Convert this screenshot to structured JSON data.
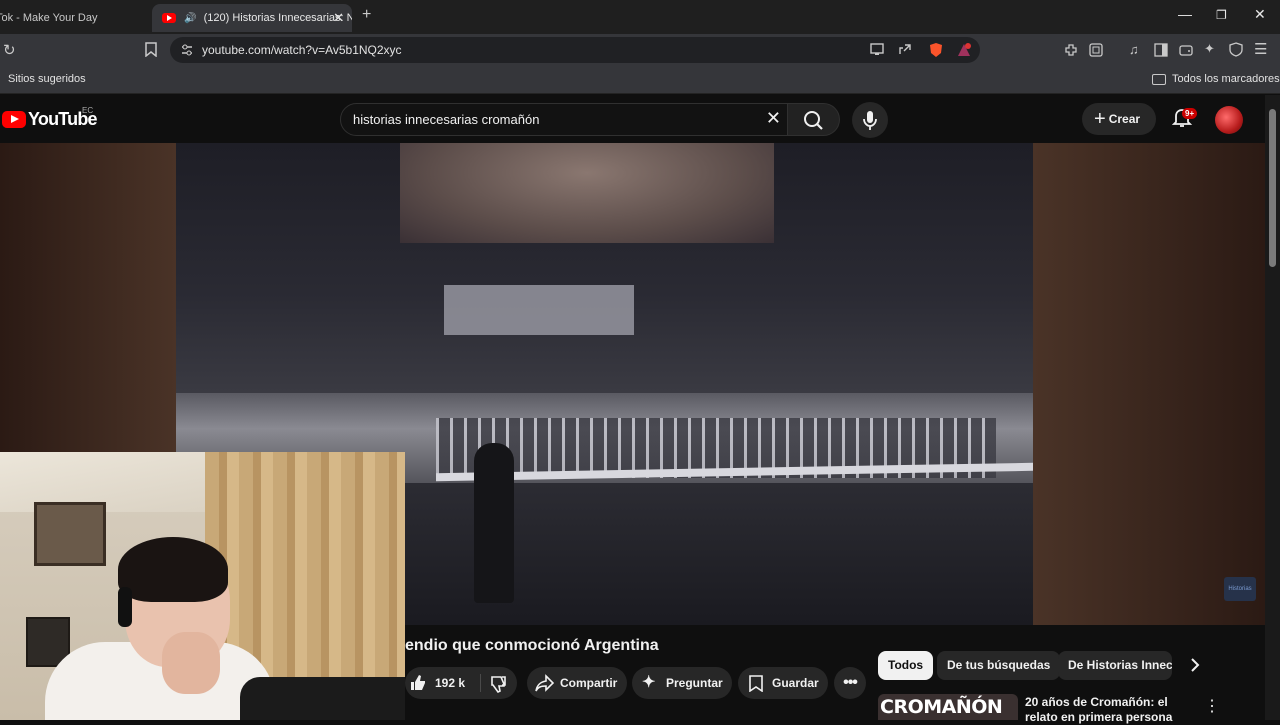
{
  "browser": {
    "tabs": [
      {
        "label": "Tok - Make Your Day"
      },
      {
        "label": "(120) Historias Innecesarias: N"
      }
    ],
    "url": "youtube.com/watch?v=Av5b1NQ2xyc",
    "bookmarks": {
      "suggested": "Sitios sugeridos",
      "all": "Todos los marcadores"
    }
  },
  "youtube": {
    "logo_text": "YouTube",
    "country_code": "EC",
    "search_query": "historias innecesarias cromañón",
    "create_label": "Crear",
    "notification_count": "9+"
  },
  "video": {
    "title": "endio que conmocionó Argentina",
    "likes": "192 k",
    "actions": {
      "share": "Compartir",
      "ask": "Preguntar",
      "save": "Guardar"
    },
    "watermark": "Historias"
  },
  "sidebar": {
    "chips": [
      "Todos",
      "De tus búsquedas",
      "De Historias Innece"
    ],
    "recommendation": {
      "thumb_text": "CROMAÑÓN",
      "title": "20 años de Cromañón: el relato en primera persona"
    }
  }
}
